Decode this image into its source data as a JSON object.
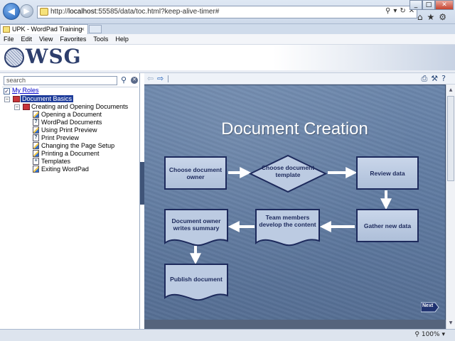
{
  "browser": {
    "url_prefix": "http://",
    "url_host": "localhost",
    "url_rest": ":55585/data/toc.html?keep-alive-timer#",
    "tab_title": "UPK - WordPad Training",
    "tab_close": "×",
    "zoom": "100%",
    "zoom_arrow": "▾"
  },
  "menu": [
    "File",
    "Edit",
    "View",
    "Favorites",
    "Tools",
    "Help"
  ],
  "banner": {
    "logo_text": "WSG"
  },
  "sidebar": {
    "search_placeholder": "search",
    "my_roles": "My Roles",
    "root": "Document Basics",
    "group": "Creating and Opening Documents",
    "items": [
      "Opening a Document",
      "WordPad Documents",
      "Using Print Preview",
      "Print Preview",
      "Changing the Page Setup",
      "Printing a Document",
      "Templates",
      "Exiting WordPad"
    ]
  },
  "slide": {
    "title": "Document Creation",
    "nodes": {
      "choose_owner": "Choose document owner",
      "choose_template": "Choose document template",
      "review": "Review data",
      "gather": "Gather new data",
      "team": "Team members develop the content",
      "owner_summary": "Document owner writes summary",
      "publish": "Publish document"
    },
    "next_label": "Next",
    "colors": {
      "node_fill": "#bccbe2",
      "node_border": "#1d2a5c",
      "arrow": "#ffffff"
    }
  }
}
